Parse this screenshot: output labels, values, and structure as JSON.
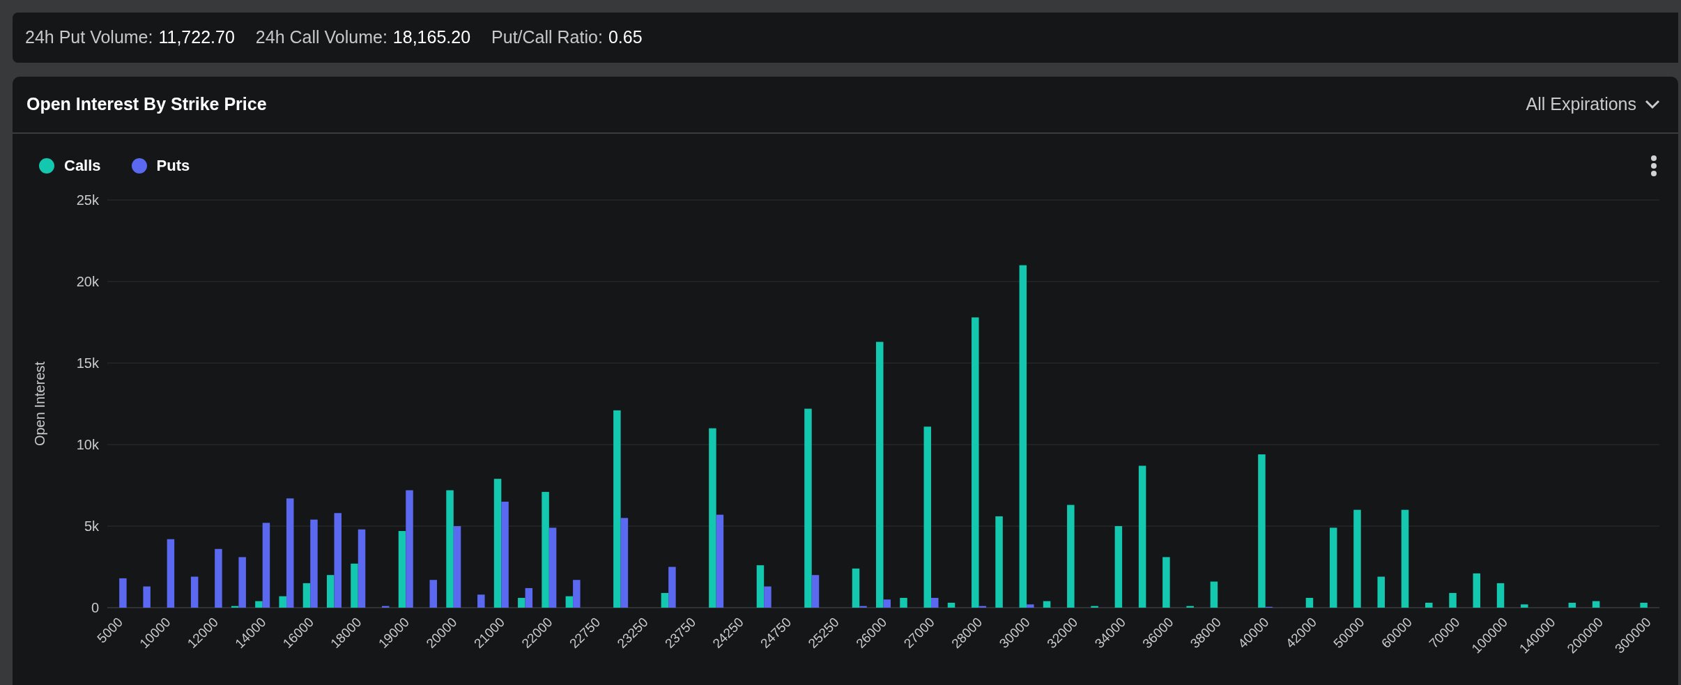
{
  "stats": [
    {
      "label": "24h Put Volume:",
      "value": "11,722.70"
    },
    {
      "label": "24h Call Volume:",
      "value": "18,165.20"
    },
    {
      "label": "Put/Call Ratio:",
      "value": "0.65"
    }
  ],
  "panel": {
    "title": "Open Interest By Strike Price",
    "dropdown": "All Expirations",
    "chart_data": {
      "type": "bar",
      "ylabel": "Open Interest",
      "categories": [
        "5000",
        null,
        "10000",
        null,
        "12000",
        null,
        "14000",
        null,
        "16000",
        null,
        "18000",
        null,
        "19000",
        null,
        "20000",
        null,
        "21000",
        null,
        "22000",
        null,
        "22750",
        null,
        "23250",
        null,
        "23750",
        null,
        "24250",
        null,
        "24750",
        null,
        "25250",
        null,
        "26000",
        null,
        "27000",
        null,
        "28000",
        null,
        "30000",
        null,
        "32000",
        null,
        "34000",
        null,
        "36000",
        null,
        "38000",
        null,
        "40000",
        null,
        "42000",
        null,
        "50000",
        null,
        "60000",
        null,
        "70000",
        null,
        "100000",
        null,
        "140000",
        null,
        "200000",
        null,
        "300000"
      ],
      "series": [
        {
          "name": "Calls",
          "color": "#14c8b0",
          "values": [
            0,
            0,
            0,
            0,
            0,
            100,
            400,
            700,
            1500,
            2000,
            2700,
            0,
            4700,
            0,
            7200,
            0,
            7900,
            600,
            7100,
            700,
            0,
            12100,
            0,
            900,
            0,
            11000,
            0,
            2600,
            0,
            12200,
            0,
            2400,
            16300,
            600,
            11100,
            300,
            17800,
            5600,
            21000,
            400,
            6300,
            100,
            5000,
            8700,
            3100,
            100,
            1600,
            0,
            9400,
            0,
            600,
            4900,
            6000,
            1900,
            6000,
            300,
            900,
            2100,
            1500,
            200,
            0,
            300,
            400,
            0,
            300
          ]
        },
        {
          "name": "Puts",
          "color": "#5b68f0",
          "values": [
            1800,
            1300,
            4200,
            1900,
            3600,
            3100,
            5200,
            6700,
            5400,
            5800,
            4800,
            100,
            7200,
            1700,
            5000,
            800,
            6500,
            1200,
            4900,
            1700,
            0,
            5500,
            0,
            2500,
            0,
            5700,
            0,
            1300,
            0,
            2000,
            0,
            100,
            500,
            0,
            600,
            0,
            100,
            0,
            200,
            0,
            0,
            0,
            0,
            0,
            0,
            0,
            0,
            0,
            50,
            0,
            0,
            0,
            0,
            0,
            0,
            0,
            0,
            0,
            0,
            0,
            0,
            0,
            0,
            0,
            0
          ]
        }
      ],
      "ylim": [
        0,
        25000
      ],
      "grid": true,
      "yticks": [
        {
          "value": 0,
          "label": "0"
        },
        {
          "value": 5000,
          "label": "5k"
        },
        {
          "value": 10000,
          "label": "10k"
        },
        {
          "value": 15000,
          "label": "15k"
        },
        {
          "value": 20000,
          "label": "20k"
        },
        {
          "value": 25000,
          "label": "25k"
        }
      ]
    }
  }
}
